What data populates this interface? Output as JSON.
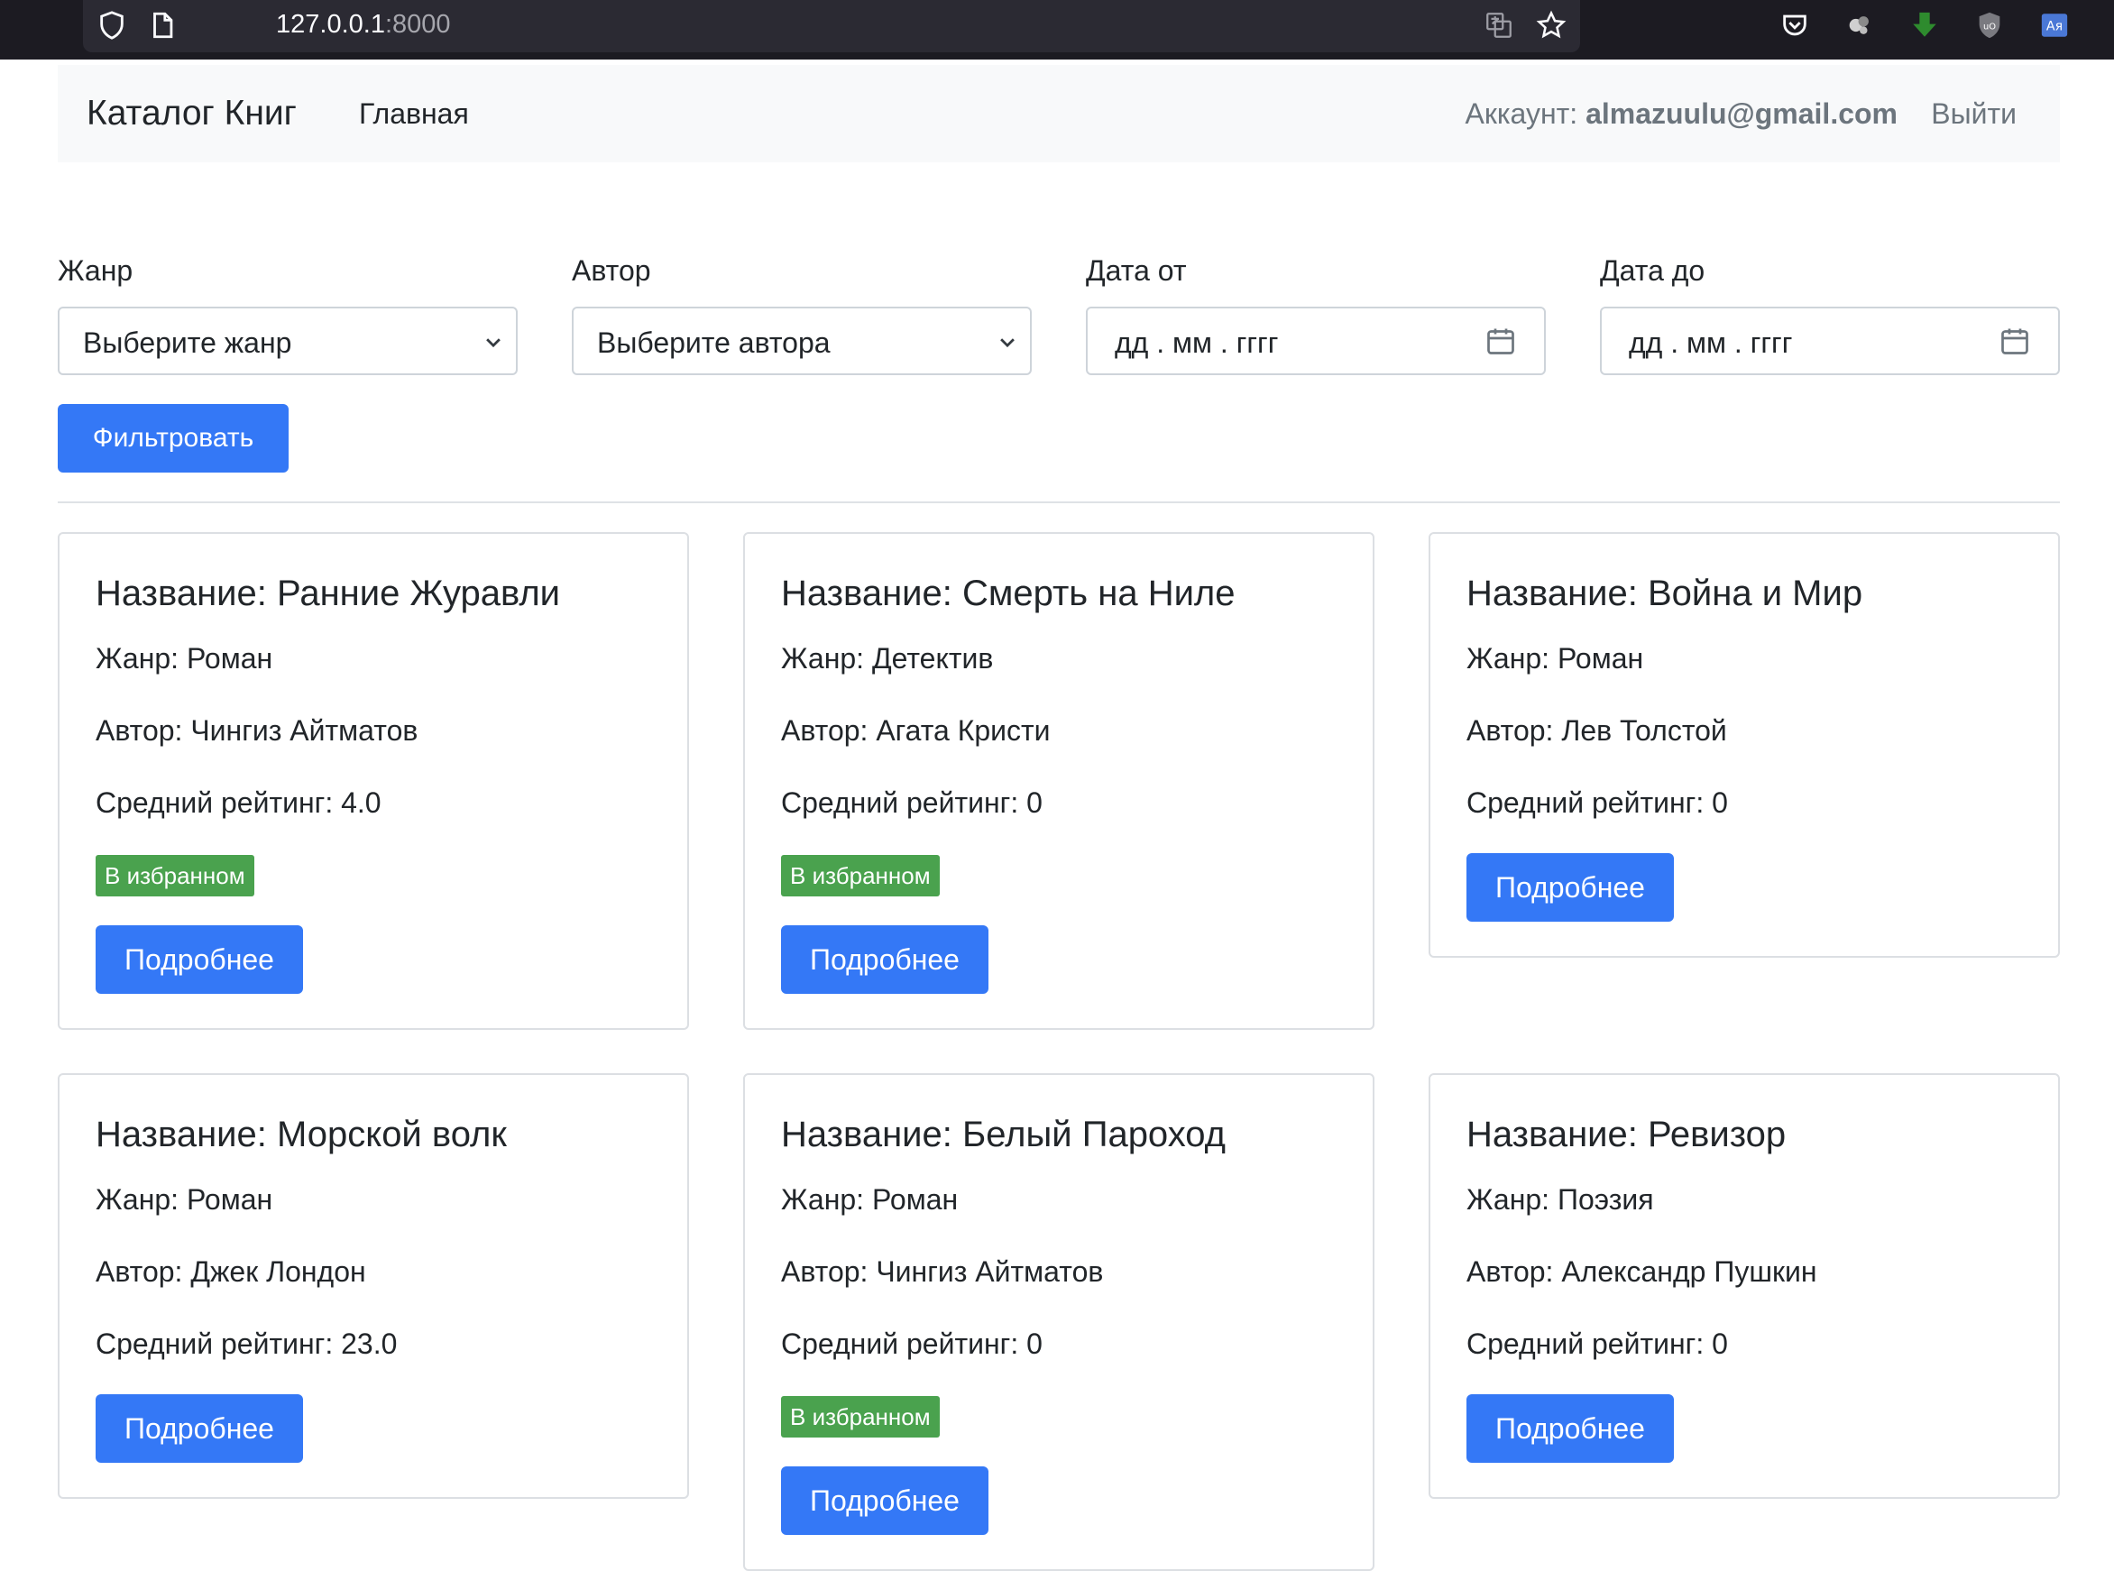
{
  "browser": {
    "url_host": "127.0.0.1",
    "url_port": ":8000"
  },
  "navbar": {
    "brand": "Каталог Книг",
    "home": "Главная",
    "account_label": "Аккаунт:",
    "account_email": "almazuulu@gmail.com",
    "logout": "Выйти"
  },
  "filters": {
    "genre_label": "Жанр",
    "genre_value": "Выберите жанр",
    "author_label": "Автор",
    "author_value": "Выберите автора",
    "date_from_label": "Дата от",
    "date_from_value": "дд . мм . гггг",
    "date_to_label": "Дата до",
    "date_to_value": "дд . мм . гггг",
    "submit": "Фильтровать"
  },
  "books": [
    {
      "title": "Название: Ранние Журавли",
      "genre": "Жанр: Роман",
      "author": "Автор: Чингиз Айтматов",
      "rating": "Средний рейтинг: 4.0",
      "favorite": "В избранном",
      "more": "Подробнее"
    },
    {
      "title": "Название: Смерть на Ниле",
      "genre": "Жанр: Детектив",
      "author": "Автор: Агата Кристи",
      "rating": "Средний рейтинг: 0",
      "favorite": "В избранном",
      "more": "Подробнее"
    },
    {
      "title": "Название: Война и Мир",
      "genre": "Жанр: Роман",
      "author": "Автор: Лев Толстой",
      "rating": "Средний рейтинг: 0",
      "more": "Подробнее"
    },
    {
      "title": "Название: Морской волк",
      "genre": "Жанр: Роман",
      "author": "Автор: Джек Лондон",
      "rating": "Средний рейтинг: 23.0",
      "more": "Подробнее"
    },
    {
      "title": "Название: Белый Пароход",
      "genre": "Жанр: Роман",
      "author": "Автор: Чингиз Айтматов",
      "rating": "Средний рейтинг: 0",
      "favorite": "В избранном",
      "more": "Подробнее"
    },
    {
      "title": "Название: Ревизор",
      "genre": "Жанр: Поэзия",
      "author": "Автор: Александр Пушкин",
      "rating": "Средний рейтинг: 0",
      "more": "Подробнее"
    }
  ]
}
